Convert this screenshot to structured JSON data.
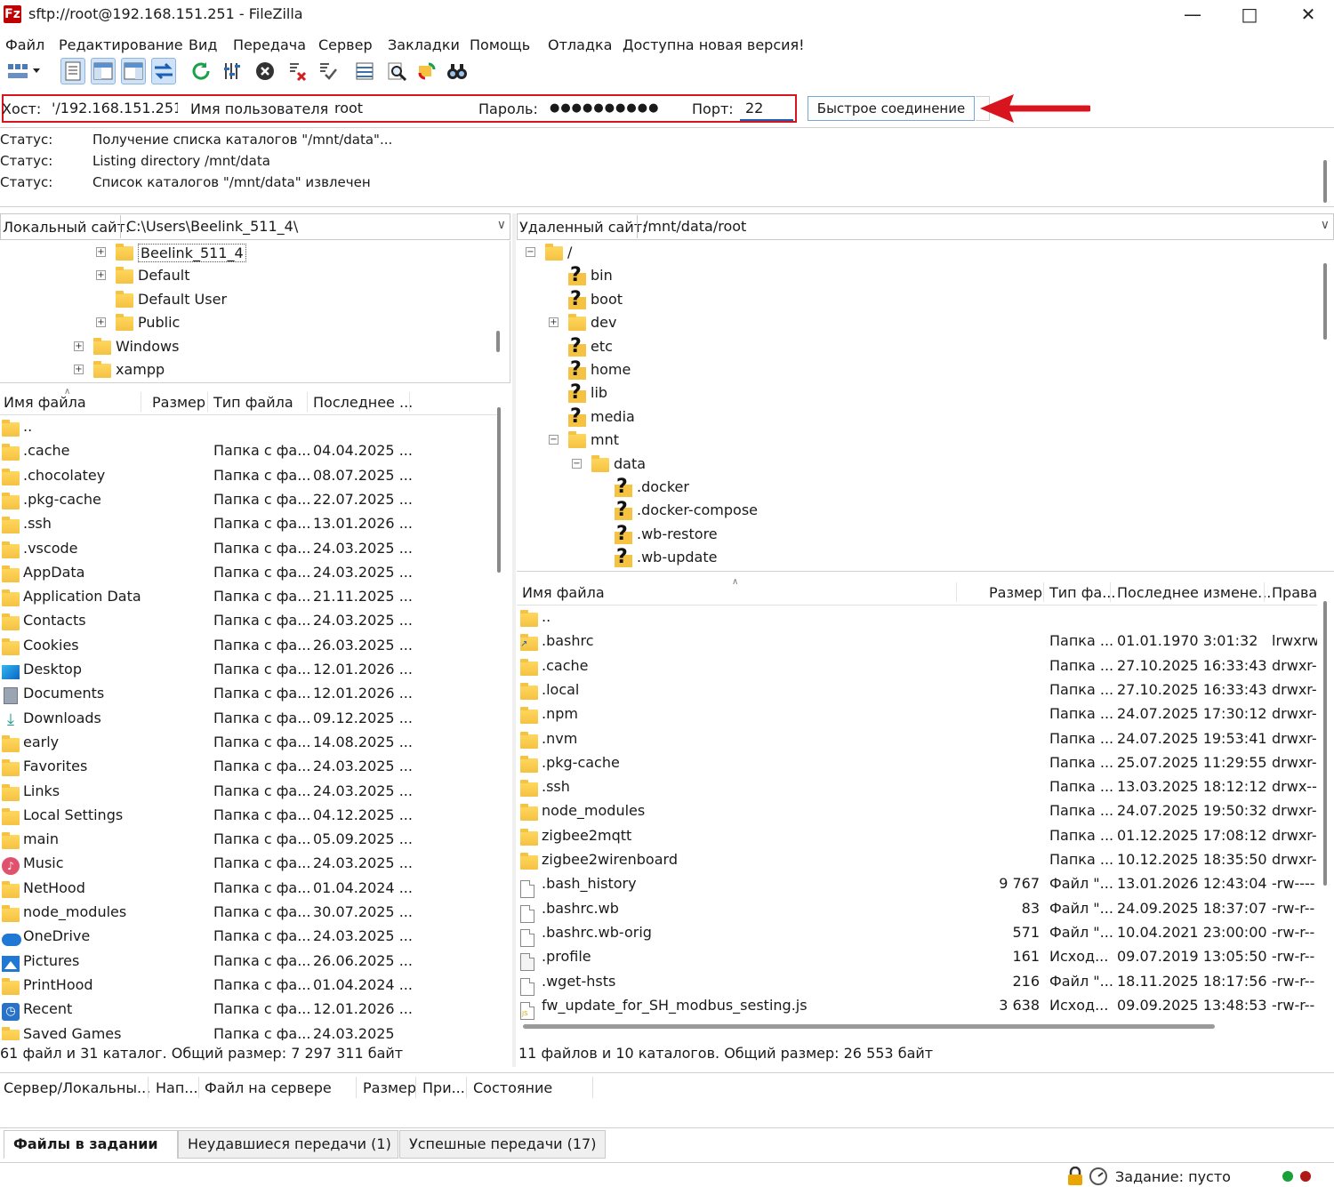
{
  "window": {
    "title": "sftp://root@192.168.151.251 - FileZilla",
    "app_icon": "Fz"
  },
  "menu": [
    "Файл",
    "Редактирование",
    "Вид",
    "Передача",
    "Сервер",
    "Закладки",
    "Помощь",
    "Отладка",
    "Доступна новая версия!"
  ],
  "toolbar_icons": [
    "site-manager-icon",
    "toggle-message-log-icon",
    "toggle-local-tree-icon",
    "toggle-remote-tree-icon",
    "toggle-transfer-queue-icon",
    "refresh-icon",
    "process-queue-icon",
    "cancel-icon",
    "disconnect-icon",
    "reconnect-icon",
    "directory-listing-filters-icon",
    "search-remote-icon",
    "synchronized-browsing-icon",
    "directory-comparison-icon"
  ],
  "quickconnect": {
    "host_label": "Хост:",
    "host_value": "'/192.168.151.251",
    "user_label": "Имя пользователя:",
    "user_value": "root",
    "pass_label": "Пароль:",
    "pass_value": "●●●●●●●●●●",
    "port_label": "Порт:",
    "port_value": "22",
    "button": "Быстрое соединение",
    "arrow_color": "#d8141e"
  },
  "log": [
    {
      "key": "Статус:",
      "value": "Получение списка каталогов \"/mnt/data\"..."
    },
    {
      "key": "Статус:",
      "value": "Listing directory /mnt/data"
    },
    {
      "key": "Статус:",
      "value": "Список каталогов \"/mnt/data\" извлечен"
    }
  ],
  "local": {
    "site_label": "Локальный сайт:",
    "path": "C:\\Users\\Beelink_511_4\\",
    "tree": [
      {
        "name": "Beelink_511_4",
        "level": 2,
        "exp": "+",
        "sel": true
      },
      {
        "name": "Default",
        "level": 2,
        "exp": "+"
      },
      {
        "name": "Default User",
        "level": 2,
        "exp": ""
      },
      {
        "name": "Public",
        "level": 2,
        "exp": "+"
      },
      {
        "name": "Windows",
        "level": 1,
        "exp": "+"
      },
      {
        "name": "xampp",
        "level": 1,
        "exp": "+"
      }
    ],
    "columns": [
      "Имя файла",
      "Размер",
      "Тип файла",
      "Последнее ..."
    ],
    "files": [
      {
        "name": "..",
        "size": "",
        "type": "",
        "date": "",
        "icon": "folder"
      },
      {
        "name": ".cache",
        "size": "",
        "type": "Папка с фа...",
        "date": "04.04.2025 ...",
        "icon": "folder"
      },
      {
        "name": ".chocolatey",
        "size": "",
        "type": "Папка с фа...",
        "date": "08.07.2025 ...",
        "icon": "folder"
      },
      {
        "name": ".pkg-cache",
        "size": "",
        "type": "Папка с фа...",
        "date": "22.07.2025 ...",
        "icon": "folder"
      },
      {
        "name": ".ssh",
        "size": "",
        "type": "Папка с фа...",
        "date": "13.01.2026 ...",
        "icon": "folder"
      },
      {
        "name": ".vscode",
        "size": "",
        "type": "Папка с фа...",
        "date": "24.03.2025 ...",
        "icon": "folder"
      },
      {
        "name": "AppData",
        "size": "",
        "type": "Папка с фа...",
        "date": "24.03.2025 ...",
        "icon": "folder"
      },
      {
        "name": "Application Data",
        "size": "",
        "type": "Папка с фа...",
        "date": "21.11.2025 ...",
        "icon": "folder"
      },
      {
        "name": "Contacts",
        "size": "",
        "type": "Папка с фа...",
        "date": "24.03.2025 ...",
        "icon": "folder"
      },
      {
        "name": "Cookies",
        "size": "",
        "type": "Папка с фа...",
        "date": "26.03.2025 ...",
        "icon": "folder"
      },
      {
        "name": "Desktop",
        "size": "",
        "type": "Папка с фа...",
        "date": "12.01.2026 ...",
        "icon": "desktop"
      },
      {
        "name": "Documents",
        "size": "",
        "type": "Папка с фа...",
        "date": "12.01.2026 ...",
        "icon": "documents"
      },
      {
        "name": "Downloads",
        "size": "",
        "type": "Папка с фа...",
        "date": "09.12.2025 ...",
        "icon": "downloads"
      },
      {
        "name": "early",
        "size": "",
        "type": "Папка с фа...",
        "date": "14.08.2025 ...",
        "icon": "folder"
      },
      {
        "name": "Favorites",
        "size": "",
        "type": "Папка с фа...",
        "date": "24.03.2025 ...",
        "icon": "folder"
      },
      {
        "name": "Links",
        "size": "",
        "type": "Папка с фа...",
        "date": "24.03.2025 ...",
        "icon": "folder"
      },
      {
        "name": "Local Settings",
        "size": "",
        "type": "Папка с фа...",
        "date": "04.12.2025 ...",
        "icon": "folder"
      },
      {
        "name": "main",
        "size": "",
        "type": "Папка с фа...",
        "date": "05.09.2025 ...",
        "icon": "folder"
      },
      {
        "name": "Music",
        "size": "",
        "type": "Папка с фа...",
        "date": "24.03.2025 ...",
        "icon": "music"
      },
      {
        "name": "NetHood",
        "size": "",
        "type": "Папка с фа...",
        "date": "01.04.2024 ...",
        "icon": "folder"
      },
      {
        "name": "node_modules",
        "size": "",
        "type": "Папка с фа...",
        "date": "30.07.2025 ...",
        "icon": "folder"
      },
      {
        "name": "OneDrive",
        "size": "",
        "type": "Папка с фа...",
        "date": "24.03.2025 ...",
        "icon": "onedrive"
      },
      {
        "name": "Pictures",
        "size": "",
        "type": "Папка с фа...",
        "date": "26.06.2025 ...",
        "icon": "pictures"
      },
      {
        "name": "PrintHood",
        "size": "",
        "type": "Папка с фа...",
        "date": "01.04.2024 ...",
        "icon": "folder"
      },
      {
        "name": "Recent",
        "size": "",
        "type": "Папка с фа...",
        "date": "12.01.2026 ...",
        "icon": "recent"
      },
      {
        "name": "Saved Games",
        "size": "",
        "type": "Папка с фа...",
        "date": "24.03.2025",
        "icon": "folder"
      }
    ],
    "status": "61 файл и 31 каталог. Общий размер: 7 297 311 байт"
  },
  "remote": {
    "site_label": "Удаленный сайт:",
    "path": "/mnt/data/root",
    "tree": [
      {
        "name": "/",
        "level": 0,
        "exp": "-",
        "icon": "folder"
      },
      {
        "name": "bin",
        "level": 1,
        "exp": "",
        "icon": "unknown"
      },
      {
        "name": "boot",
        "level": 1,
        "exp": "",
        "icon": "unknown"
      },
      {
        "name": "dev",
        "level": 1,
        "exp": "+",
        "icon": "folder"
      },
      {
        "name": "etc",
        "level": 1,
        "exp": "",
        "icon": "unknown"
      },
      {
        "name": "home",
        "level": 1,
        "exp": "",
        "icon": "unknown"
      },
      {
        "name": "lib",
        "level": 1,
        "exp": "",
        "icon": "unknown"
      },
      {
        "name": "media",
        "level": 1,
        "exp": "",
        "icon": "unknown"
      },
      {
        "name": "mnt",
        "level": 1,
        "exp": "-",
        "icon": "folder"
      },
      {
        "name": "data",
        "level": 2,
        "exp": "-",
        "icon": "folder"
      },
      {
        "name": ".docker",
        "level": 3,
        "exp": "",
        "icon": "unknown"
      },
      {
        "name": ".docker-compose",
        "level": 3,
        "exp": "",
        "icon": "unknown"
      },
      {
        "name": ".wb-restore",
        "level": 3,
        "exp": "",
        "icon": "unknown"
      },
      {
        "name": ".wb-update",
        "level": 3,
        "exp": "",
        "icon": "unknown"
      }
    ],
    "columns": [
      "Имя файла",
      "Размер",
      "Тип фа...",
      "Последнее измене...",
      "Права"
    ],
    "files": [
      {
        "name": "..",
        "size": "",
        "type": "",
        "date": "",
        "perm": "",
        "icon": "folder"
      },
      {
        "name": ".bashrc",
        "size": "",
        "type": "Папка ...",
        "date": "01.01.1970 3:01:32",
        "perm": "lrwxrw",
        "icon": "link"
      },
      {
        "name": ".cache",
        "size": "",
        "type": "Папка ...",
        "date": "27.10.2025 16:33:43",
        "perm": "drwxr-",
        "icon": "folder"
      },
      {
        "name": ".local",
        "size": "",
        "type": "Папка ...",
        "date": "27.10.2025 16:33:43",
        "perm": "drwxr-",
        "icon": "folder"
      },
      {
        "name": ".npm",
        "size": "",
        "type": "Папка ...",
        "date": "24.07.2025 17:30:12",
        "perm": "drwxr-",
        "icon": "folder"
      },
      {
        "name": ".nvm",
        "size": "",
        "type": "Папка ...",
        "date": "24.07.2025 19:53:41",
        "perm": "drwxr-",
        "icon": "folder"
      },
      {
        "name": ".pkg-cache",
        "size": "",
        "type": "Папка ...",
        "date": "25.07.2025 11:29:55",
        "perm": "drwxr-",
        "icon": "folder"
      },
      {
        "name": ".ssh",
        "size": "",
        "type": "Папка ...",
        "date": "13.03.2025 18:12:12",
        "perm": "drwx--",
        "icon": "folder"
      },
      {
        "name": "node_modules",
        "size": "",
        "type": "Папка ...",
        "date": "24.07.2025 19:50:32",
        "perm": "drwxr-",
        "icon": "folder"
      },
      {
        "name": "zigbee2mqtt",
        "size": "",
        "type": "Папка ...",
        "date": "01.12.2025 17:08:12",
        "perm": "drwxr-",
        "icon": "folder"
      },
      {
        "name": "zigbee2wirenboard",
        "size": "",
        "type": "Папка ...",
        "date": "10.12.2025 18:35:50",
        "perm": "drwxr-",
        "icon": "folder"
      },
      {
        "name": ".bash_history",
        "size": "9 767",
        "type": "Файл \"...",
        "date": "13.01.2026 12:43:04",
        "perm": "-rw----",
        "icon": "file"
      },
      {
        "name": ".bashrc.wb",
        "size": "83",
        "type": "Файл \"...",
        "date": "24.09.2025 18:37:07",
        "perm": "-rw-r--",
        "icon": "file"
      },
      {
        "name": ".bashrc.wb-orig",
        "size": "571",
        "type": "Файл \"...",
        "date": "10.04.2021 23:00:00",
        "perm": "-rw-r--",
        "icon": "file"
      },
      {
        "name": ".profile",
        "size": "161",
        "type": "Исход...",
        "date": "09.07.2019 13:05:50",
        "perm": "-rw-r--",
        "icon": "script"
      },
      {
        "name": ".wget-hsts",
        "size": "216",
        "type": "Файл \"...",
        "date": "18.11.2025 18:17:56",
        "perm": "-rw-r--",
        "icon": "file"
      },
      {
        "name": "fw_update_for_SH_modbus_sesting.js",
        "size": "3 638",
        "type": "Исход...",
        "date": "09.09.2025 13:48:53",
        "perm": "-rw-r--",
        "icon": "js"
      }
    ],
    "status": "11 файлов и 10 каталогов. Общий размер: 26 553 байт"
  },
  "queue": {
    "columns": [
      "Сервер/Локальны...",
      "Нап...",
      "Файл на сервере",
      "Размер",
      "При...",
      "Состояние"
    ],
    "tabs": [
      "Файлы в задании",
      "Неудавшиеся передачи (1)",
      "Успешные передачи (17)"
    ]
  },
  "statusbar": {
    "queue_text": "Задание: пусто"
  }
}
